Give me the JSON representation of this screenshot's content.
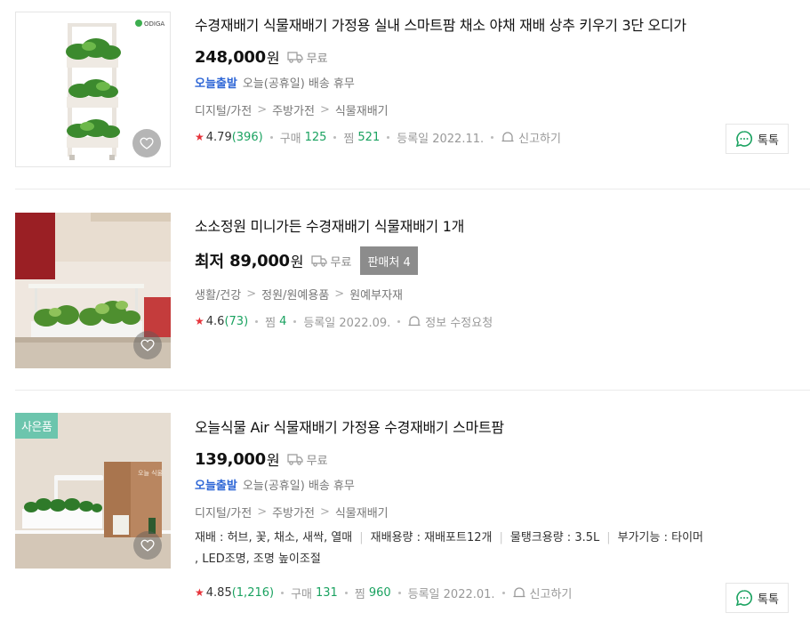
{
  "products": [
    {
      "title": "수경재배기 식물재배기 가정용 실내 스마트팜 채소 야채 재배 상추 키우기 3단 오디가",
      "price": "248,000",
      "won": "원",
      "shipping": "무료",
      "delivery_badge": "오늘출발",
      "delivery_text": "오늘(공휴일) 배송 휴무",
      "category": [
        "디지털/가전",
        "주방가전",
        "식물재배기"
      ],
      "rating": "4.79",
      "reviews": "(396)",
      "purchase_label": "구매",
      "purchase_count": "125",
      "wish_label": "찜",
      "wish_count": "521",
      "reg_date": "등록일 2022.11.",
      "report": "신고하기",
      "talk": "톡톡",
      "brand_logo": "ODIGA"
    },
    {
      "title": "소소정원 미니가든 수경재배기 식물재배기 1개",
      "price_prefix": "최저",
      "price": "89,000",
      "won": "원",
      "shipping": "무료",
      "seller_count": "판매처 4",
      "category": [
        "생활/건강",
        "정원/원예용품",
        "원예부자재"
      ],
      "rating": "4.6",
      "reviews": "(73)",
      "wish_label": "찜",
      "wish_count": "4",
      "reg_date": "등록일 2022.09.",
      "report": "정보 수정요청"
    },
    {
      "title": "오늘식물 Air 식물재배기 가정용 수경재배기 스마트팜",
      "price": "139,000",
      "won": "원",
      "shipping": "무료",
      "delivery_badge": "오늘출발",
      "delivery_text": "오늘(공휴일) 배송 휴무",
      "category": [
        "디지털/가전",
        "주방가전",
        "식물재배기"
      ],
      "specs": [
        "재배 : 허브, 꽃, 채소, 새싹, 열매",
        "재배용량 : 재배포트12개",
        "물탱크용량 : 3.5L",
        "부가기능 : 타이머",
        ", LED조명, 조명 높이조절"
      ],
      "rating": "4.85",
      "reviews": "(1,216)",
      "purchase_label": "구매",
      "purchase_count": "131",
      "wish_label": "찜",
      "wish_count": "960",
      "reg_date": "등록일 2022.01.",
      "report": "신고하기",
      "talk": "톡톡",
      "gift_badge": "사은품",
      "box_text": "오늘 식물"
    }
  ],
  "colors": {
    "green": "#1aa260",
    "blue": "#2f67d6",
    "star": "#e6333a",
    "gift": "#6cc5ad"
  },
  "icons": [
    "heart-icon",
    "truck-icon",
    "bell-icon",
    "chat-icon",
    "star-icon"
  ]
}
